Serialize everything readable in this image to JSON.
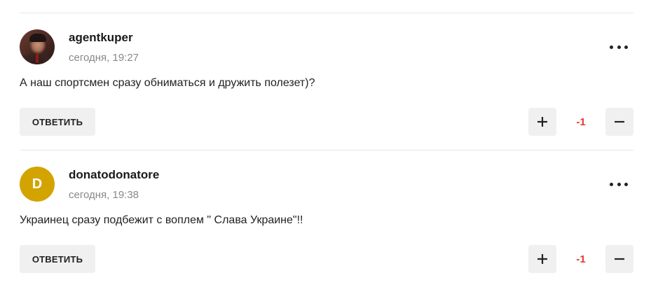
{
  "comments": [
    {
      "author": "agentkuper",
      "time": "сегодня, 19:27",
      "text": "А наш спортсмен сразу обниматься и дружить полезет)?",
      "avatar": {
        "type": "photo"
      },
      "reply_label": "ОТВЕТИТЬ",
      "score": "-1"
    },
    {
      "author": "donatodonatore",
      "time": "сегодня, 19:38",
      "text": "Украинец сразу подбежит с воплем \" Слава Украине\"!!",
      "avatar": {
        "type": "initial",
        "letter": "D",
        "color": "#d3a300"
      },
      "reply_label": "ОТВЕТИТЬ",
      "score": "-1"
    }
  ],
  "colors": {
    "score_negative": "#e53935",
    "button_bg": "#f0f0f0"
  },
  "icons": {
    "more": "more-dots-icon",
    "plus": "plus-icon",
    "minus": "minus-icon"
  }
}
